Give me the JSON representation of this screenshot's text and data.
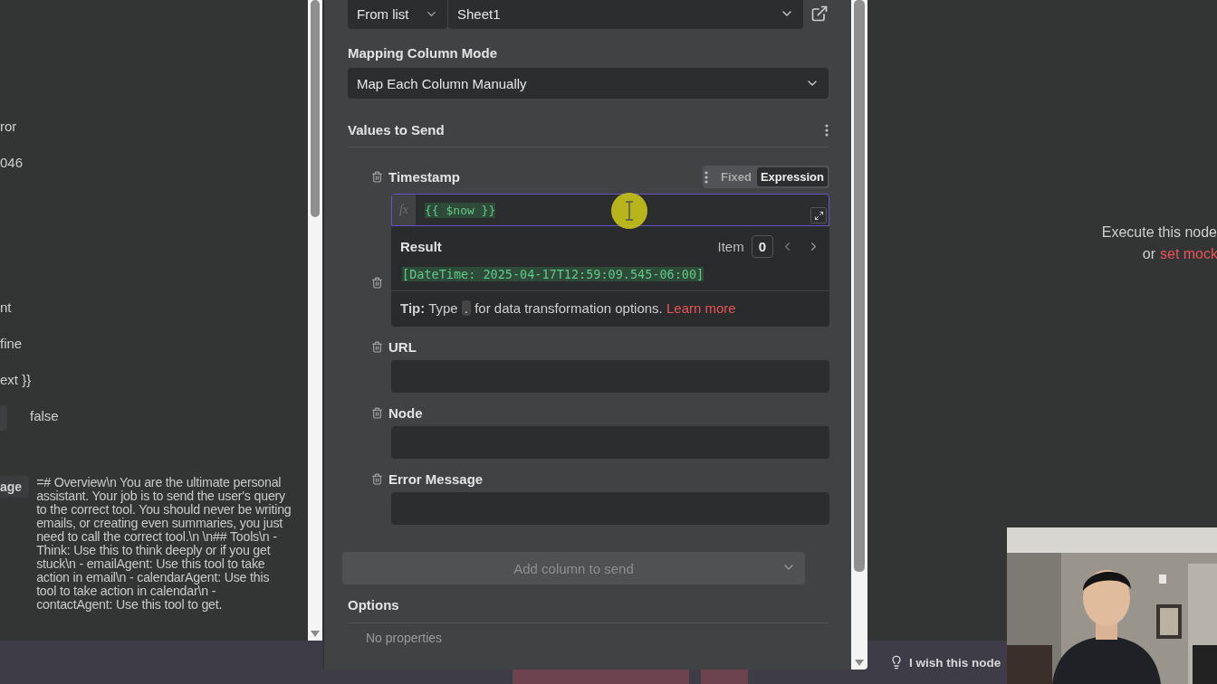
{
  "left_panel": {
    "rows": [
      {
        "kind": "text",
        "label": "ror"
      },
      {
        "kind": "text",
        "label": "046"
      },
      {
        "kind": "gap"
      },
      {
        "kind": "gap"
      },
      {
        "kind": "gap"
      },
      {
        "kind": "text",
        "label": "nt"
      },
      {
        "kind": "text",
        "label": "fine"
      },
      {
        "kind": "text",
        "label": "ext }}"
      },
      {
        "kind": "chip",
        "label": "false"
      }
    ],
    "message": {
      "label": "age",
      "value": "=# Overview\\n You are the ultimate personal assistant. Your job is to send the user's query to the correct tool. You should never be writing emails, or creating even summaries, you just need to call the correct tool.\\n \\n## Tools\\n - Think: Use this to think deeply or if you get stuck\\n - emailAgent: Use this tool to take action in email\\n - calendarAgent: Use this tool to take action in calendar\\n - contactAgent: Use this tool to get."
    }
  },
  "document": {
    "mode": "From list",
    "sheet": "Sheet1"
  },
  "mapping_mode": {
    "label": "Mapping Column Mode",
    "value": "Map Each Column Manually"
  },
  "values_section": {
    "title": "Values to Send",
    "fields": [
      {
        "kind": "expression",
        "label": "Timestamp",
        "prefix_label": "fx",
        "value": "{{ $now }}",
        "mode_tabs": [
          {
            "label": "Fixed",
            "selected": false
          },
          {
            "label": "Expression",
            "selected": true
          }
        ],
        "result": {
          "label": "Result",
          "item_label": "Item",
          "item_value": "0",
          "value": "[DateTime: 2025-04-17T12:59:09.545-06:00]",
          "tip_prefix": "Tip:",
          "tip_before": "Type",
          "tip_key": ".",
          "tip_after": "for data transformation options.",
          "tip_link": "Learn more"
        }
      },
      {
        "kind": "empty",
        "label": "URL"
      },
      {
        "kind": "empty",
        "label": "Node"
      },
      {
        "kind": "empty",
        "label": "Error Message"
      }
    ]
  },
  "add_column": {
    "label": "Add column to send"
  },
  "options": {
    "title": "Options",
    "empty_text": "No properties"
  },
  "output_panel": {
    "hint": "Execute this node",
    "hint_prefix": "or",
    "hint_link": "set mock"
  },
  "footer": {
    "feedback": "I wish this node"
  }
}
